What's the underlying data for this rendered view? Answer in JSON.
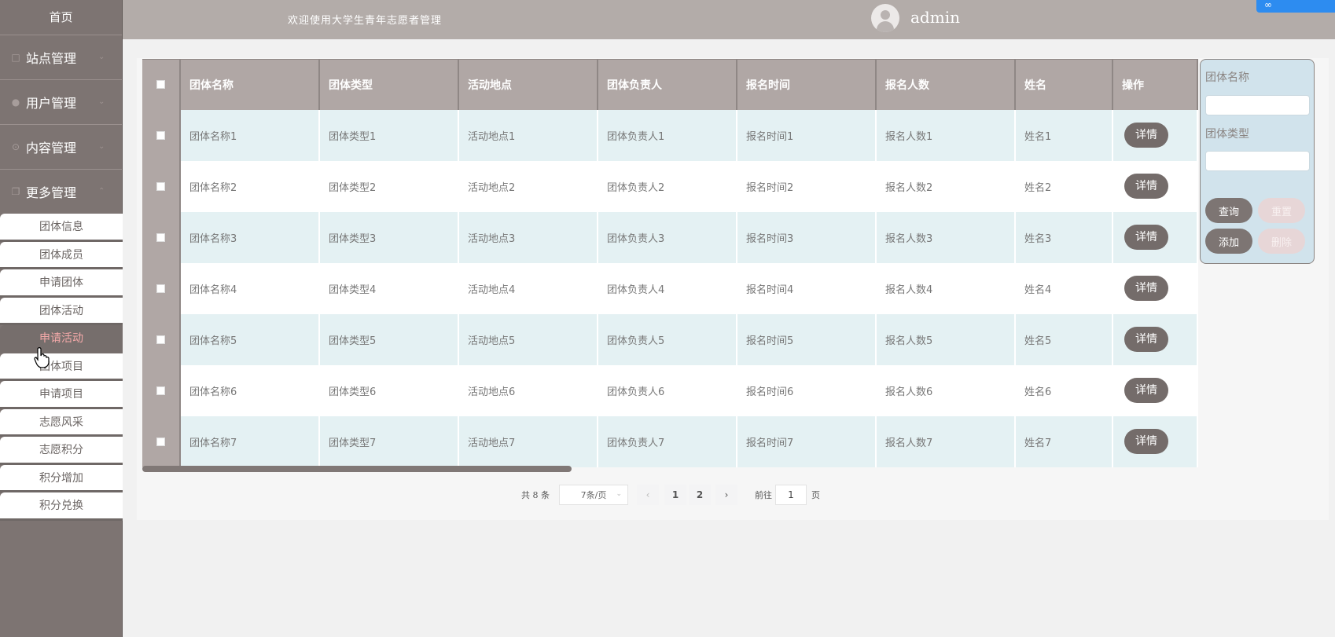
{
  "sidebar": {
    "home": "首页",
    "groups": [
      {
        "label": "站点管理",
        "icon": "monitor-icon"
      },
      {
        "label": "用户管理",
        "icon": "user-icon"
      },
      {
        "label": "内容管理",
        "icon": "list-icon"
      },
      {
        "label": "更多管理",
        "icon": "copy-icon"
      }
    ],
    "sub_items": [
      "团体信息",
      "团体成员",
      "申请团体",
      "团体活动",
      "申请活动",
      "团体项目",
      "申请项目",
      "志愿风采",
      "志愿积分",
      "积分增加",
      "积分兑换"
    ],
    "active_sub": "申请活动"
  },
  "header": {
    "welcome": "欢迎使用大学生青年志愿者管理",
    "username": "admin"
  },
  "table": {
    "columns": [
      "团体名称",
      "团体类型",
      "活动地点",
      "团体负责人",
      "报名时间",
      "报名人数",
      "姓名",
      "操作"
    ],
    "rows": [
      [
        "团体名称1",
        "团体类型1",
        "活动地点1",
        "团体负责人1",
        "报名时间1",
        "报名人数1",
        "姓名1"
      ],
      [
        "团体名称2",
        "团体类型2",
        "活动地点2",
        "团体负责人2",
        "报名时间2",
        "报名人数2",
        "姓名2"
      ],
      [
        "团体名称3",
        "团体类型3",
        "活动地点3",
        "团体负责人3",
        "报名时间3",
        "报名人数3",
        "姓名3"
      ],
      [
        "团体名称4",
        "团体类型4",
        "活动地点4",
        "团体负责人4",
        "报名时间4",
        "报名人数4",
        "姓名4"
      ],
      [
        "团体名称5",
        "团体类型5",
        "活动地点5",
        "团体负责人5",
        "报名时间5",
        "报名人数5",
        "姓名5"
      ],
      [
        "团体名称6",
        "团体类型6",
        "活动地点6",
        "团体负责人6",
        "报名时间6",
        "报名人数6",
        "姓名6"
      ],
      [
        "团体名称7",
        "团体类型7",
        "活动地点7",
        "团体负责人7",
        "报名时间7",
        "报名人数7",
        "姓名7"
      ]
    ],
    "action_label": "详情"
  },
  "pagination": {
    "total": "共 8 条",
    "page_size": "7条/页",
    "pages": [
      "1",
      "2"
    ],
    "goto_label": "前往",
    "goto_value": "1",
    "goto_unit": "页"
  },
  "search": {
    "field1_label": "团体名称",
    "field2_label": "团体类型",
    "query_label": "查询",
    "reset_label": "重置",
    "add_label": "添加",
    "delete_label": "删除"
  },
  "colors": {
    "sidebar_bg": "#7d7472",
    "header_bg": "#b3aca9",
    "row_tint": "#e4f1f3",
    "accent_text": "#f4a9a9"
  }
}
